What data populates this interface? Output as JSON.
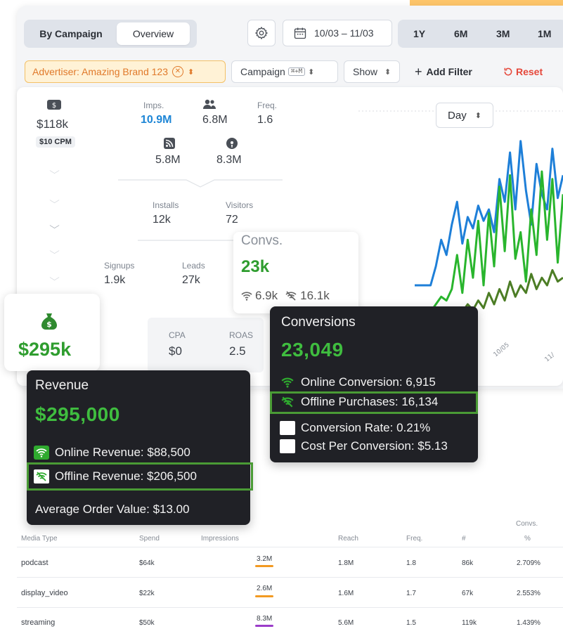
{
  "header": {
    "view_tabs": [
      "By Campaign",
      "Overview"
    ],
    "date_range": "10/03 – 11/03",
    "ranges": [
      "1Y",
      "6M",
      "3M",
      "1M"
    ]
  },
  "filters": {
    "advertiser": "Advertiser: Amazing Brand 123",
    "campaign": "Campaign",
    "campaign_shortcut": "⌘+M",
    "show": "Show",
    "add_filter": "Add Filter",
    "reset": "Reset"
  },
  "metrics": {
    "spend": "$118k",
    "cpm": "$10 CPM",
    "imps_label": "Imps.",
    "imps": "10.9M",
    "reach": "6.8M",
    "freq_label": "Freq.",
    "freq": "1.6",
    "rss_value": "5.8M",
    "podcast_value": "8.3M",
    "installs_label": "Installs",
    "installs": "12k",
    "visitors_label": "Visitors",
    "visitors": "72",
    "signups_label": "Signups",
    "signups": "1.9k",
    "leads_label": "Leads",
    "leads": "27k",
    "convs_label": "Convs.",
    "convs": "23k",
    "convs_online": "6.9k",
    "convs_offline": "16.1k",
    "revenue": "$295k",
    "cpa_label": "CPA",
    "cpa": "$0",
    "roas_label": "ROAS",
    "roas": "2.5"
  },
  "chart": {
    "granularity": "Day",
    "x_ticks": [
      "10/05",
      "11/"
    ]
  },
  "chart_data": {
    "type": "line",
    "series": [
      {
        "color": "#1e7fd8",
        "values": [
          1,
          1,
          1,
          1,
          1.5,
          2.2,
          1.8,
          2.6,
          3.2,
          2.1,
          2.8,
          2.5,
          3.1,
          2.7,
          3.0,
          2.4,
          3.8,
          3.2,
          4.5,
          3.0,
          4.8,
          3.5,
          2.6,
          4.2,
          3.4,
          3.0,
          4.6,
          3.3,
          3.9
        ]
      },
      {
        "color": "#29b52d",
        "values": [
          0.3,
          0.3,
          0.3,
          0.3,
          0.5,
          0.7,
          0.6,
          0.9,
          1.8,
          0.8,
          2.2,
          1.2,
          2.7,
          1.0,
          2.9,
          1.5,
          3.6,
          1.9,
          3.9,
          1.7,
          2.4,
          1.1,
          3.0,
          1.8,
          4.0,
          2.2,
          3.8,
          1.6,
          3.4
        ]
      },
      {
        "color": "#4c7d25",
        "values": [
          0.1,
          0.1,
          0.1,
          0.1,
          0.15,
          0.2,
          0.2,
          0.25,
          0.4,
          0.3,
          0.5,
          0.35,
          0.6,
          0.4,
          0.8,
          0.5,
          0.9,
          0.6,
          1.1,
          0.7,
          1.0,
          0.8,
          1.3,
          0.9,
          1.2,
          1.0,
          1.4,
          1.1,
          1.2
        ]
      }
    ]
  },
  "revenue_tooltip": {
    "title": "Revenue",
    "total": "$295,000",
    "online": "Online Revenue: $88,500",
    "offline": "Offline Revenue: $206,500",
    "aov": "Average Order Value: $13.00"
  },
  "conversions_tooltip": {
    "title": "Conversions",
    "total": "23,049",
    "online": "Online Conversion: 6,915",
    "offline": "Offline Purchases: 16,134",
    "rate": "Conversion Rate: 0.21%",
    "cost": "Cost Per Conversion: $5.13"
  },
  "table": {
    "headers": [
      "Media Type",
      "Spend",
      "Impressions",
      "Reach",
      "Freq.",
      "#",
      "%"
    ],
    "group_header": "Convs.",
    "rows": [
      {
        "media": "podcast",
        "spend": "$64k",
        "impressions": "3.2M",
        "bar_color": "#f29a22",
        "reach": "1.8M",
        "freq": "1.8",
        "count": "86k",
        "pct": "2.709%"
      },
      {
        "media": "display_video",
        "spend": "$22k",
        "impressions": "2.6M",
        "bar_color": "#f29a22",
        "reach": "1.6M",
        "freq": "1.7",
        "count": "67k",
        "pct": "2.553%"
      },
      {
        "media": "streaming",
        "spend": "$50k",
        "impressions": "8.3M",
        "bar_color": "#9b3cc9",
        "reach": "5.6M",
        "freq": "1.5",
        "count": "119k",
        "pct": "1.439%"
      }
    ]
  },
  "colors": {
    "accent_green": "#3fbd3f",
    "accent_blue": "#1e86d6",
    "warning_orange": "#e0792a",
    "reset_red": "#e5483b"
  }
}
